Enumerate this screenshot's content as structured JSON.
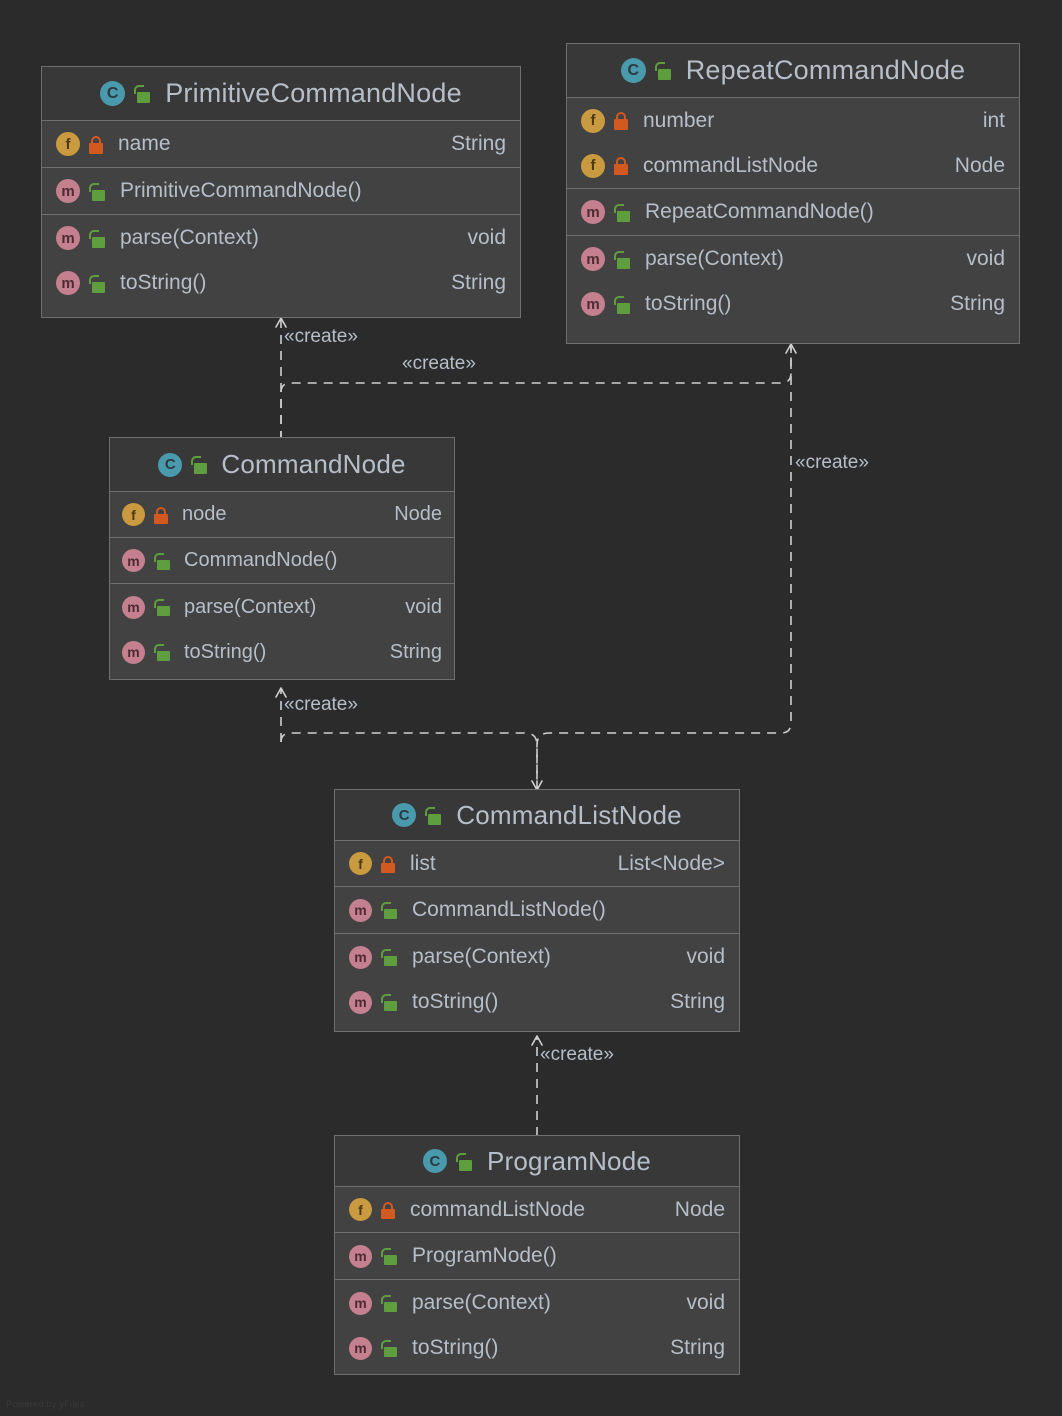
{
  "diagram": {
    "title": "UML Class Diagram",
    "background_color": "#2b2b2b",
    "watermark": "Powered by yFiles",
    "edge_style": "dashed-dependency",
    "colors": {
      "box_fill": "#424242",
      "header_fill": "#383838",
      "border": "#6f6f6f",
      "text": "#b6bfc9",
      "class_badge": "#4a9aae",
      "field_badge": "#c99a3f",
      "method_badge": "#c4808f",
      "public_lock": "#5f9e3f",
      "private_lock": "#d2591f",
      "edge": "#cfcfcf"
    }
  },
  "icons": {
    "class": "C",
    "field": "f",
    "method": "m",
    "public": "unlocked-padlock",
    "private": "locked-padlock"
  },
  "classes": [
    {
      "id": "primitive-command-node",
      "name": "PrimitiveCommandNode",
      "visibility": "public",
      "fields": [
        {
          "name": "name",
          "type": "String",
          "visibility": "private"
        }
      ],
      "constructors": [
        {
          "name": "PrimitiveCommandNode()",
          "type": "",
          "visibility": "public"
        }
      ],
      "methods": [
        {
          "name": "parse(Context)",
          "type": "void",
          "visibility": "public"
        },
        {
          "name": "toString()",
          "type": "String",
          "visibility": "public"
        }
      ]
    },
    {
      "id": "repeat-command-node",
      "name": "RepeatCommandNode",
      "visibility": "public",
      "fields": [
        {
          "name": "number",
          "type": "int",
          "visibility": "private"
        },
        {
          "name": "commandListNode",
          "type": "Node",
          "visibility": "private"
        }
      ],
      "constructors": [
        {
          "name": "RepeatCommandNode()",
          "type": "",
          "visibility": "public"
        }
      ],
      "methods": [
        {
          "name": "parse(Context)",
          "type": "void",
          "visibility": "public"
        },
        {
          "name": "toString()",
          "type": "String",
          "visibility": "public"
        }
      ]
    },
    {
      "id": "command-node",
      "name": "CommandNode",
      "visibility": "public",
      "fields": [
        {
          "name": "node",
          "type": "Node",
          "visibility": "private"
        }
      ],
      "constructors": [
        {
          "name": "CommandNode()",
          "type": "",
          "visibility": "public"
        }
      ],
      "methods": [
        {
          "name": "parse(Context)",
          "type": "void",
          "visibility": "public"
        },
        {
          "name": "toString()",
          "type": "String",
          "visibility": "public"
        }
      ]
    },
    {
      "id": "command-list-node",
      "name": "CommandListNode",
      "visibility": "public",
      "fields": [
        {
          "name": "list",
          "type": "List<Node>",
          "visibility": "private"
        }
      ],
      "constructors": [
        {
          "name": "CommandListNode()",
          "type": "",
          "visibility": "public"
        }
      ],
      "methods": [
        {
          "name": "parse(Context)",
          "type": "void",
          "visibility": "public"
        },
        {
          "name": "toString()",
          "type": "String",
          "visibility": "public"
        }
      ]
    },
    {
      "id": "program-node",
      "name": "ProgramNode",
      "visibility": "public",
      "fields": [
        {
          "name": "commandListNode",
          "type": "Node",
          "visibility": "private"
        }
      ],
      "constructors": [
        {
          "name": "ProgramNode()",
          "type": "",
          "visibility": "public"
        }
      ],
      "methods": [
        {
          "name": "parse(Context)",
          "type": "void",
          "visibility": "public"
        },
        {
          "name": "toString()",
          "type": "String",
          "visibility": "public"
        }
      ]
    }
  ],
  "relationships": [
    {
      "id": "cn-to-pcn",
      "from": "CommandNode",
      "to": "PrimitiveCommandNode",
      "stereotype": "«create»",
      "type": "dependency"
    },
    {
      "id": "cn-to-rcn",
      "from": "CommandNode",
      "to": "RepeatCommandNode",
      "stereotype": "«create»",
      "type": "dependency"
    },
    {
      "id": "cln-to-cn",
      "from": "CommandListNode",
      "to": "CommandNode",
      "stereotype": "«create»",
      "type": "dependency"
    },
    {
      "id": "rcn-to-cln",
      "from": "RepeatCommandNode",
      "to": "CommandListNode",
      "stereotype": "«create»",
      "type": "dependency"
    },
    {
      "id": "pn-to-cln",
      "from": "ProgramNode",
      "to": "CommandListNode",
      "stereotype": "«create»",
      "type": "dependency"
    }
  ],
  "edge_labels": [
    {
      "id": "label-pcn",
      "text": "«create»"
    },
    {
      "id": "label-rcn-top",
      "text": "«create»"
    },
    {
      "id": "label-rcn-right",
      "text": "«create»"
    },
    {
      "id": "label-cn",
      "text": "«create»"
    },
    {
      "id": "label-pn",
      "text": "«create»"
    }
  ]
}
